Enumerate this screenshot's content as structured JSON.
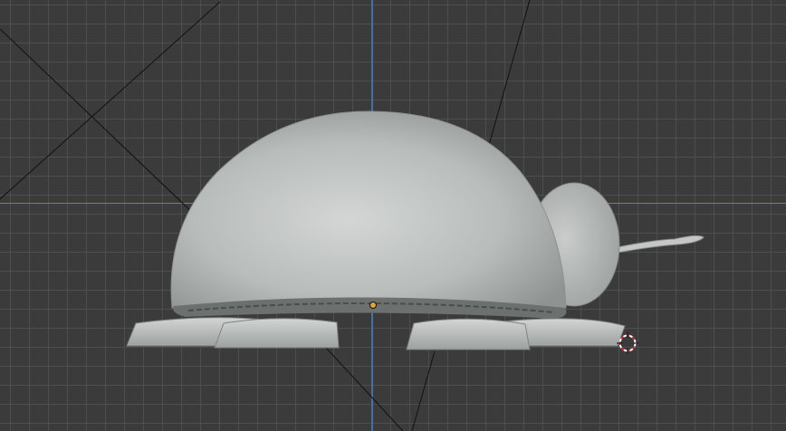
{
  "viewport": {
    "mode": "3d-viewport-front-ortho",
    "background_color": "#3b3b3b",
    "grid_color": "#505050",
    "x_axis_color": "#7a8a3c",
    "z_axis_color": "#4a6fa3"
  },
  "scene": {
    "object": "ladybug-mesh",
    "material_color": "#b9bdbc",
    "parts": [
      "shell-dome",
      "head-sphere",
      "antenna",
      "feet"
    ],
    "camera_lines_color": "#111111"
  },
  "cursor": {
    "icon": "3d-cursor-icon",
    "color": "#cc3333"
  },
  "origin": {
    "icon": "origin-dot-icon",
    "color": "#e8a23a"
  }
}
